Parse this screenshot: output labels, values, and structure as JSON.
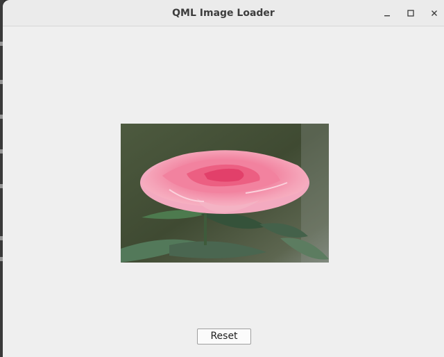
{
  "window": {
    "title": "QML Image Loader",
    "controls": [
      "minimize-icon",
      "maximize-icon",
      "close-icon"
    ]
  },
  "image": {
    "subject": "pink-rose-photo"
  },
  "reset_button": {
    "label": "Reset"
  },
  "colors": {
    "window_bg": "#efefef",
    "titlebar_bg": "#ebebeb",
    "title_text": "#3d3d3d",
    "button_border": "#9e9e9e"
  }
}
